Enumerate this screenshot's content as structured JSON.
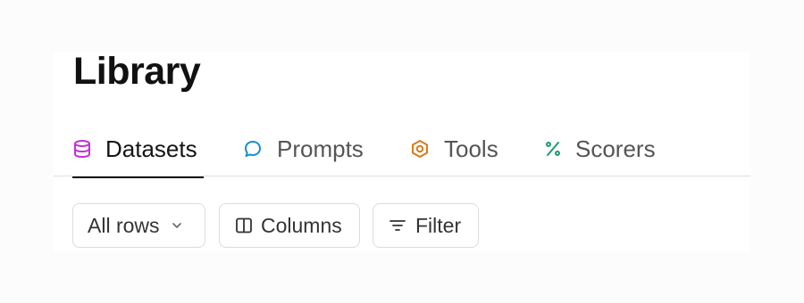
{
  "page": {
    "title": "Library"
  },
  "tabs": [
    {
      "label": "Datasets",
      "icon": "database-icon",
      "color": "#c42fd6",
      "active": true
    },
    {
      "label": "Prompts",
      "icon": "message-icon",
      "color": "#1a8fc4",
      "active": false
    },
    {
      "label": "Tools",
      "icon": "hexagon-icon",
      "color": "#d77b1c",
      "active": false
    },
    {
      "label": "Scorers",
      "icon": "percent-icon",
      "color": "#1e9a6e",
      "active": false
    }
  ],
  "toolbar": {
    "rows_select": {
      "value": "All rows",
      "icon": "chevron-down-icon"
    },
    "columns_button": {
      "label": "Columns",
      "icon": "columns-icon"
    },
    "filter_button": {
      "label": "Filter",
      "icon": "filter-icon"
    }
  }
}
